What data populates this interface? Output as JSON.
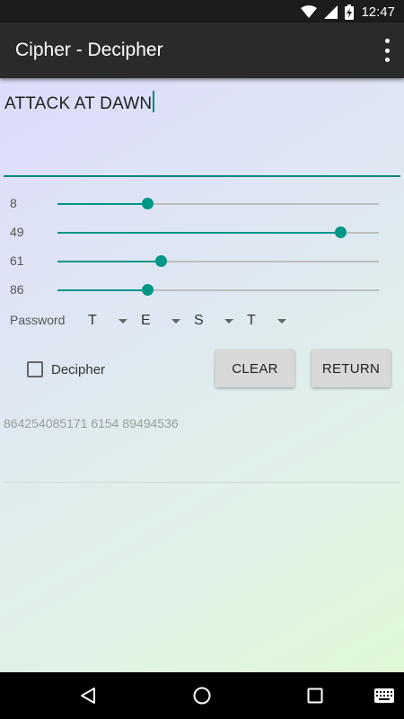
{
  "status_bar": {
    "time": "12:47",
    "icons": [
      "wifi-icon",
      "signal-icon",
      "battery-charging-icon"
    ]
  },
  "app_bar": {
    "title": "Cipher - Decipher",
    "menu_icon": "overflow-menu-icon"
  },
  "message_input": {
    "value": "ATTACK AT DAWN"
  },
  "sliders": [
    {
      "label": "8",
      "fraction": 0.28
    },
    {
      "label": "49",
      "fraction": 0.88
    },
    {
      "label": "61",
      "fraction": 0.32
    },
    {
      "label": "86",
      "fraction": 0.28
    }
  ],
  "password": {
    "label": "Password",
    "letters": [
      "T",
      "E",
      "S",
      "T"
    ]
  },
  "decipher": {
    "label": "Decipher",
    "checked": false
  },
  "buttons": {
    "clear": "CLEAR",
    "return": "RETURN"
  },
  "output": {
    "value": "864254085171 6154 89494536"
  },
  "nav_bar": {
    "icons": [
      "back-icon",
      "home-icon",
      "recents-icon",
      "keyboard-icon"
    ]
  },
  "colors": {
    "accent": "#009688",
    "app_bar": "#2a2a2a",
    "status_bar": "#1c1c1c"
  }
}
